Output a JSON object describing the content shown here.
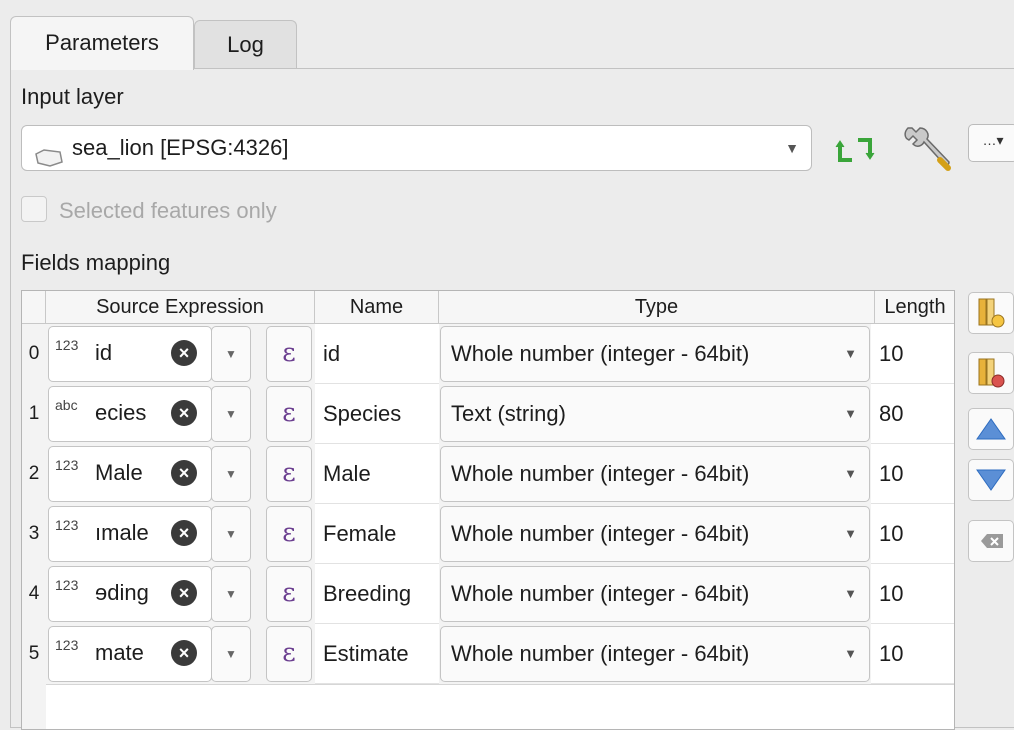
{
  "tabs": [
    {
      "label": "Parameters",
      "active": true
    },
    {
      "label": "Log",
      "active": false
    }
  ],
  "input_layer": {
    "label": "Input layer",
    "value": "sea_lion [EPSG:4326]"
  },
  "selected_only": {
    "label": "Selected features only",
    "checked": false,
    "enabled": false
  },
  "fields_mapping": {
    "label": "Fields mapping",
    "columns": [
      "Source Expression",
      "Name",
      "Type",
      "Length"
    ],
    "rows": [
      {
        "index": "0",
        "type_badge": "123",
        "source": "id",
        "name": "id",
        "type": "Whole number (integer - 64bit)",
        "length": "10"
      },
      {
        "index": "1",
        "type_badge": "abc",
        "source": "ecies",
        "name": "Species",
        "type": "Text (string)",
        "length": "80"
      },
      {
        "index": "2",
        "type_badge": "123",
        "source": "Male",
        "name": "Male",
        "type": "Whole number (integer - 64bit)",
        "length": "10"
      },
      {
        "index": "3",
        "type_badge": "123",
        "source": "ımale",
        "name": "Female",
        "type": "Whole number (integer - 64bit)",
        "length": "10"
      },
      {
        "index": "4",
        "type_badge": "123",
        "source": "ɘding",
        "name": "Breeding",
        "type": "Whole number (integer - 64bit)",
        "length": "10"
      },
      {
        "index": "5",
        "type_badge": "123",
        "source": "mate",
        "name": "Estimate",
        "type": "Whole number (integer - 64bit)",
        "length": "10"
      }
    ]
  },
  "expression_symbol": "ε",
  "colors": {
    "refresh_green": "#3aa53a",
    "arrow_blue": "#2d6cc0",
    "epsilon_purple": "#6a3d8f"
  },
  "icons": {
    "layer": "polygon-layer-icon",
    "refresh": "refresh-icon",
    "settings": "wrench-icon",
    "more": "ellipsis-icon",
    "add_field": "add-field-icon",
    "delete_field": "delete-field-icon",
    "move_up": "arrow-up-icon",
    "move_down": "arrow-down-icon",
    "reset": "clear-icon"
  }
}
